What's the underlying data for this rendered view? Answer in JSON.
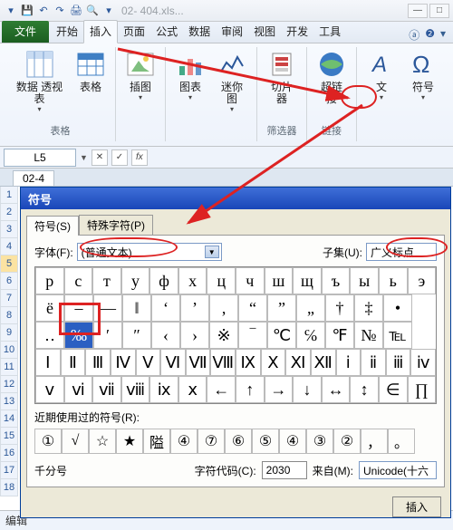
{
  "titlebar": {
    "doc": "02- 404.xls..."
  },
  "tabs": {
    "file": "文件",
    "items": [
      "开始",
      "插入",
      "页面",
      "公式",
      "数据",
      "审阅",
      "视图",
      "开发",
      "工具"
    ],
    "active": 1
  },
  "ribbon": {
    "groups": [
      {
        "label": "表格",
        "buttons": [
          {
            "name": "数据\n透视表",
            "dd": "▾"
          },
          {
            "name": "表格"
          }
        ]
      },
      {
        "label": "",
        "buttons": [
          {
            "name": "插图",
            "dd": "▾"
          }
        ]
      },
      {
        "label": "",
        "buttons": [
          {
            "name": "图表",
            "dd": "▾"
          },
          {
            "name": "迷你图",
            "dd": "▾"
          }
        ]
      },
      {
        "label": "筛选器",
        "buttons": [
          {
            "name": "切片器"
          }
        ]
      },
      {
        "label": "链接",
        "buttons": [
          {
            "name": "超链接"
          }
        ]
      },
      {
        "label": "",
        "buttons": [
          {
            "name": "文",
            "dd": "▾"
          },
          {
            "name": "符号",
            "dd": "▾"
          }
        ]
      }
    ]
  },
  "namebox": "L5",
  "fx": "fx",
  "sheet_tab": "02-4",
  "dialog": {
    "title": "符号",
    "tab_symbols": "符号(S)",
    "tab_special": "特殊字符(P)",
    "font_label": "字体(F):",
    "font_value": "(普通文本)",
    "subset_label": "子集(U):",
    "subset_value": "广义标点",
    "rows": [
      [
        "р",
        "с",
        "т",
        "у",
        "ф",
        "х",
        "ц",
        "ч",
        "ш",
        "щ",
        "ъ",
        "ы",
        "ь",
        "э"
      ],
      [
        "ё",
        "–",
        "—",
        "‖",
        "‘",
        "’",
        "‚",
        "“",
        "”",
        "„",
        "†",
        "‡",
        "•"
      ],
      [
        "‥",
        "‰",
        "′",
        "″",
        "‹",
        "›",
        "※",
        "‾",
        "℃",
        "℅",
        "℉",
        "№",
        "℡"
      ],
      [
        "Ⅰ",
        "Ⅱ",
        "Ⅲ",
        "Ⅳ",
        "Ⅴ",
        "Ⅵ",
        "Ⅶ",
        "Ⅷ",
        "Ⅸ",
        "Ⅹ",
        "Ⅺ",
        "Ⅻ",
        "ⅰ",
        "ⅱ",
        "ⅲ",
        "ⅳ"
      ],
      [
        "ⅴ",
        "ⅵ",
        "ⅶ",
        "ⅷ",
        "ⅸ",
        "ⅹ",
        "←",
        "↑",
        "→",
        "↓",
        "↔",
        "↕",
        "∈",
        "∏"
      ]
    ],
    "selected": {
      "row": 1,
      "col": -1
    },
    "permille_pos": {
      "row": 2,
      "col": 1
    },
    "recent_label": "近期使用过的符号(R):",
    "recent": [
      "①",
      "√",
      "☆",
      "★",
      "隘",
      "④",
      "⑦",
      "⑥",
      "⑤",
      "④",
      "③",
      "②",
      "，",
      "。"
    ],
    "symbol_name": "千分号",
    "charcode_label": "字符代码(C):",
    "charcode": "2030",
    "from_label": "来自(M):",
    "from_value": "Unicode(十六",
    "insert_btn": "插入"
  },
  "rowheads": [
    "1",
    "2",
    "3",
    "4",
    "5",
    "6",
    "7",
    "8",
    "9",
    "10",
    "11",
    "12",
    "13",
    "14",
    "15",
    "16",
    "17",
    "18"
  ],
  "status": "编辑"
}
